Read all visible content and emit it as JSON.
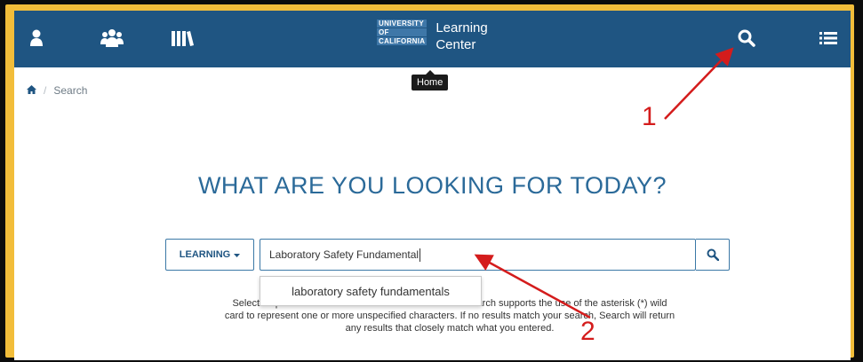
{
  "header": {
    "logo": {
      "lines": [
        "UNIVERSITY",
        "OF",
        "CALIFORNIA"
      ],
      "name_line1": "Learning",
      "name_line2": "Center"
    },
    "icons": [
      "user-icon",
      "users-group-icon",
      "library-books-icon",
      "search-icon",
      "menu-list-icon"
    ],
    "tooltip": "Home"
  },
  "breadcrumb": {
    "current": "Search"
  },
  "main": {
    "heading": "WHAT ARE YOU LOOKING FOR TODAY?",
    "type_dropdown": {
      "label": "LEARNING"
    },
    "search_input": {
      "value": "Laboratory Safety Fundamental"
    },
    "suggestion": "laboratory safety fundamentals",
    "help_lines": [
      "Select a specific                                                              earch supports the use of the asterisk (*) wild",
      "card to represent one or more unspecified characters. If no results match your search, Search will return",
      "any results that closely match what you entered."
    ]
  },
  "annotations": {
    "marker1": "1",
    "marker2": "2"
  },
  "colors": {
    "topbar": "#1f5582",
    "accent": "#2b6a99",
    "frame": "#f2bd3a",
    "annotation": "#d41c1c"
  }
}
